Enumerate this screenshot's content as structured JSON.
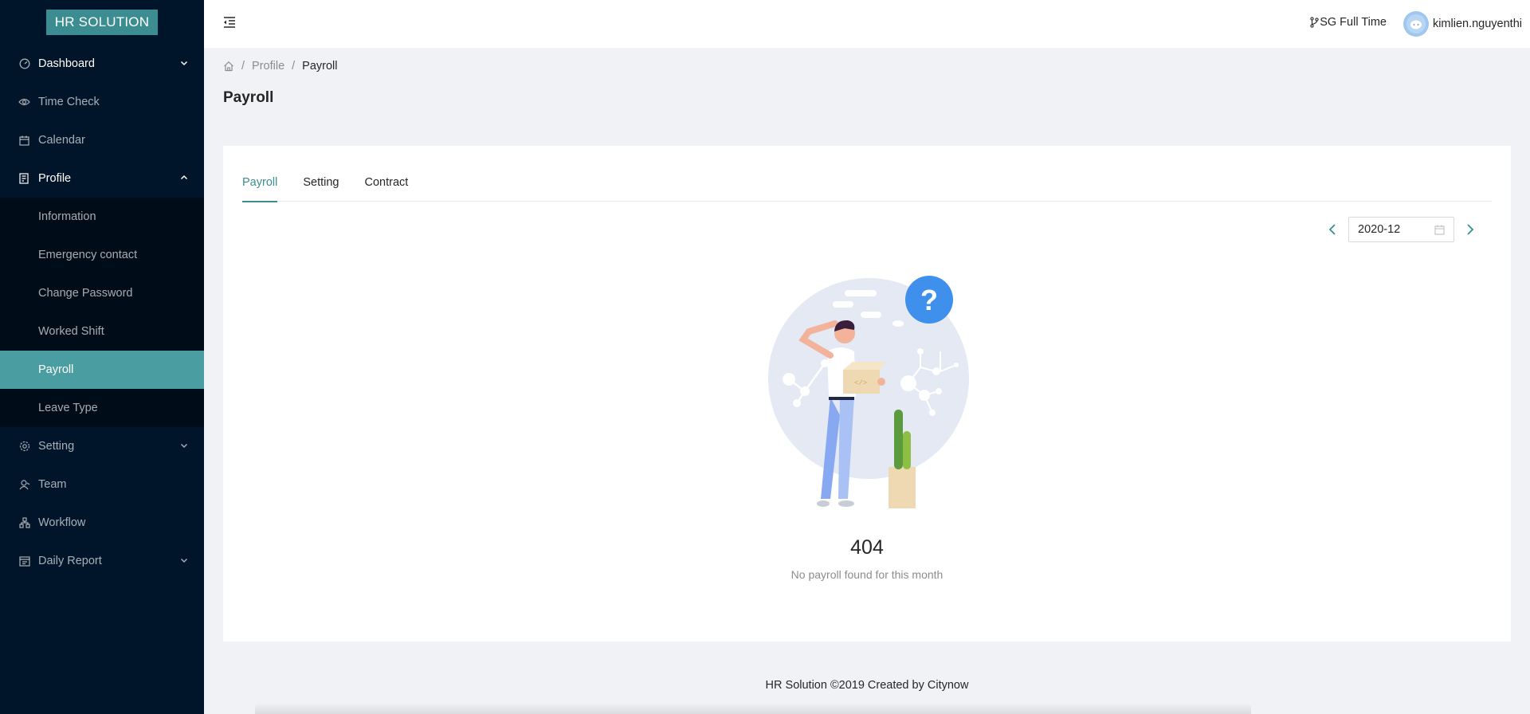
{
  "app": {
    "logo": "HR SOLUTION"
  },
  "sidebar": {
    "items": [
      {
        "label": "Dashboard",
        "icon": "dashboard-icon",
        "expandable": true
      },
      {
        "label": "Time Check",
        "icon": "eye-icon"
      },
      {
        "label": "Calendar",
        "icon": "calendar-icon"
      },
      {
        "label": "Profile",
        "icon": "profile-icon",
        "expandable": true,
        "open": true,
        "children": [
          "Information",
          "Emergency contact",
          "Change Password",
          "Worked Shift",
          "Payroll",
          "Leave Type"
        ]
      },
      {
        "label": "Setting",
        "icon": "gear-icon",
        "expandable": true
      },
      {
        "label": "Team",
        "icon": "team-icon"
      },
      {
        "label": "Workflow",
        "icon": "workflow-icon"
      },
      {
        "label": "Daily Report",
        "icon": "report-icon",
        "expandable": true
      }
    ],
    "active_sub": "Payroll"
  },
  "header": {
    "branch": "SG Full Time",
    "username": "kimlien.nguyenthi"
  },
  "breadcrumb": {
    "items": [
      "Profile",
      "Payroll"
    ]
  },
  "page": {
    "title": "Payroll"
  },
  "tabs": [
    "Payroll",
    "Setting",
    "Contract"
  ],
  "active_tab": "Payroll",
  "month_picker": {
    "value": "2020-12"
  },
  "result": {
    "code": "404",
    "message": "No payroll found for this month"
  },
  "footer": {
    "text": "HR Solution ©2019 Created by Citynow"
  },
  "colors": {
    "accent": "#3b8d91",
    "sidebar_bg": "#001529",
    "active_item": "#4a9ea1"
  }
}
